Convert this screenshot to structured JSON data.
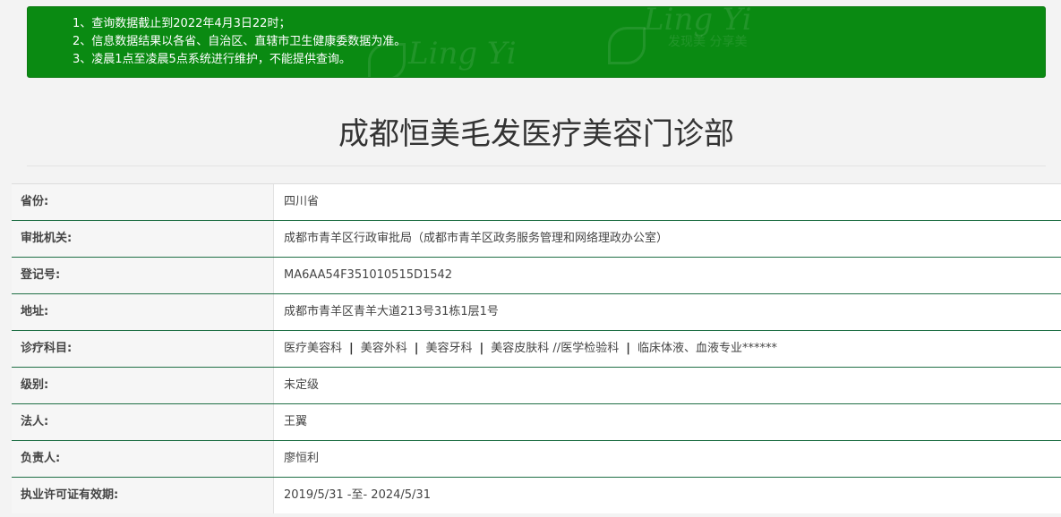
{
  "notice": {
    "items": [
      "1、查询数据截止到2022年4月3日22时；",
      "2、信息数据结果以各省、自治区、直辖市卫生健康委数据为准。",
      "3、凌晨1点至凌晨5点系统进行维护，不能提供查询。"
    ],
    "watermark_text": [
      "Ling Yi",
      "Ling Yi",
      "发现美 分享美"
    ]
  },
  "title": "成都恒美毛发医疗美容门诊部",
  "rows": [
    {
      "label": "省份:",
      "value": "四川省"
    },
    {
      "label": "审批机关:",
      "value": "成都市青羊区行政审批局（成都市青羊区政务服务管理和网络理政办公室）"
    },
    {
      "label": "登记号:",
      "value": "MA6AA54F351010515D1542"
    },
    {
      "label": "地址:",
      "value": "成都市青羊区青羊大道213号31栋1层1号"
    },
    {
      "label": "诊疗科目:",
      "departments": [
        "医疗美容科",
        "美容外科",
        "美容牙科",
        "美容皮肤科 //医学检验科",
        "临床体液、血液专业******"
      ]
    },
    {
      "label": "级别:",
      "value": "未定级"
    },
    {
      "label": "法人:",
      "value": "王翼"
    },
    {
      "label": "负责人:",
      "value": "廖恒利"
    },
    {
      "label": "执业许可证有效期:",
      "value": "2019/5/31 -至- 2024/5/31"
    }
  ],
  "colors": {
    "notice_bg": "#0a8a12",
    "row_divider": "#1f6f45"
  }
}
